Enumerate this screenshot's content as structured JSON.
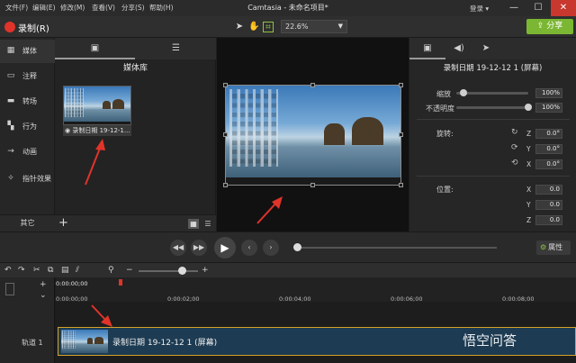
{
  "titlebar": {
    "menu": [
      "文件(F)",
      "编辑(E)",
      "修改(M)",
      "查看(V)",
      "分享(S)",
      "帮助(H)"
    ],
    "title": "Camtasia - 未命名项目*",
    "login": "登录 ▾",
    "min": "—",
    "max": "☐",
    "close": "✕"
  },
  "toolbar": {
    "record_label": "录制(R)",
    "zoom_value": "22.6%",
    "share_label": "分享",
    "accent": "#7bb733"
  },
  "nav": {
    "items": [
      {
        "label": "媒体",
        "icon": "film-icon"
      },
      {
        "label": "注释",
        "icon": "annotation-icon"
      },
      {
        "label": "转场",
        "icon": "transition-icon"
      },
      {
        "label": "行为",
        "icon": "behavior-icon"
      },
      {
        "label": "动画",
        "icon": "animation-icon"
      },
      {
        "label": "指针效果",
        "icon": "cursor-effect-icon"
      }
    ],
    "more": "其它"
  },
  "media": {
    "title": "媒体库",
    "clip_name": "录制日期 19-12-1..."
  },
  "properties": {
    "title": "录制日期 19-12-12 1 (屏幕)",
    "scale_label": "缩放",
    "scale_value": "100%",
    "scale_fraction": 1.0,
    "opacity_label": "不透明度",
    "opacity_value": "100%",
    "opacity_fraction": 1.0,
    "rotation_label": "旋转:",
    "rotation": {
      "z": "0.0°",
      "y": "0.0°",
      "x": "0.0°"
    },
    "position_label": "位置:",
    "position": {
      "x": "0.0",
      "y": "0.0",
      "z": "0.0"
    }
  },
  "playback": {
    "props_label": "属性"
  },
  "timeline": {
    "playhead_time": "0:00:00;00",
    "ticks": [
      "0:00:00;00",
      "0:00:02;00",
      "0:00:04;00",
      "0:00:06;00",
      "0:00:08;00"
    ],
    "track_name": "轨道 1",
    "clip_label": "录制日期 19-12-12 1 (屏幕)"
  },
  "watermark": "悟空问答"
}
